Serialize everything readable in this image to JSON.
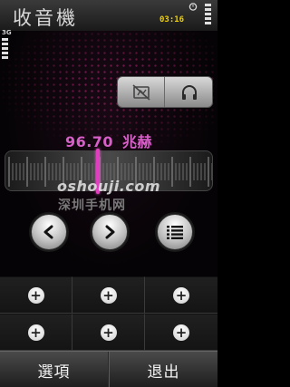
{
  "titlebar": {
    "title": "收音機",
    "clock": "03:16",
    "network_label_line1": "3G",
    "network_label_line2": "⁺"
  },
  "tuner": {
    "frequency": "96.70",
    "unit": "兆赫",
    "output_left_icon": "speaker-muted-icon",
    "output_right_icon": "headphones-icon"
  },
  "watermark": {
    "line1": "oshouji.com",
    "line2": "深圳手机网"
  },
  "controls": {
    "prev_icon": "chevron-left-icon",
    "next_icon": "chevron-right-icon",
    "list_icon": "list-icon"
  },
  "presets": [
    "+",
    "+",
    "+",
    "+",
    "+",
    "+"
  ],
  "softkeys": {
    "left": "選項",
    "right": "退出"
  },
  "colors": {
    "accent": "#d75fc8",
    "clock": "#f0d000",
    "needle": "#e040c0"
  }
}
